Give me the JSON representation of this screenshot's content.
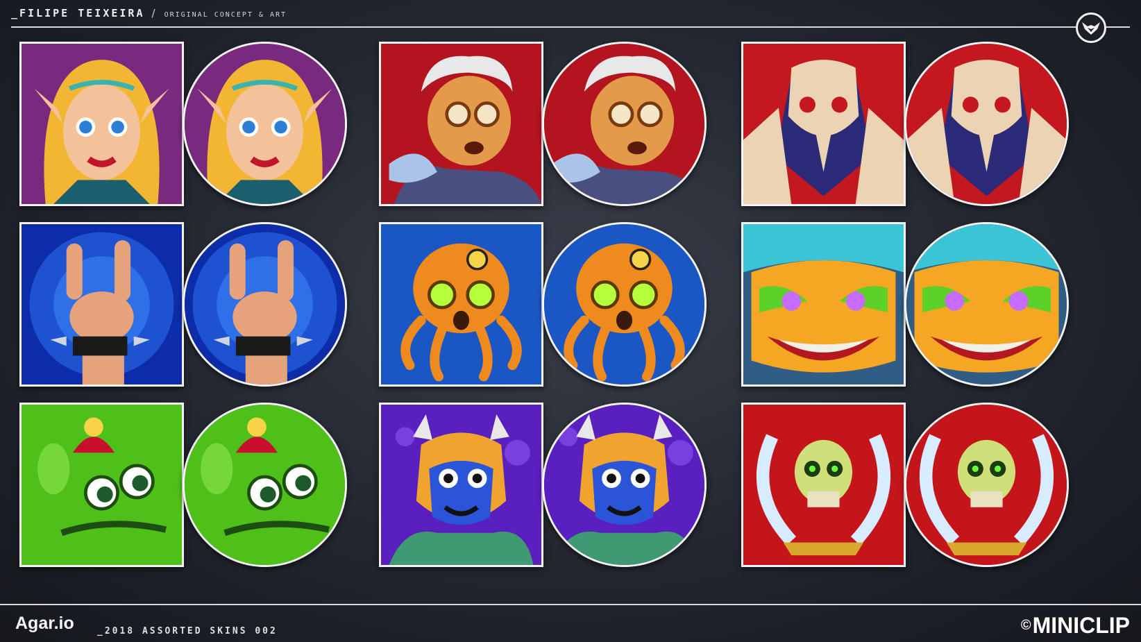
{
  "header": {
    "author": "_FILIPE TEIXEIRA",
    "separator": "/",
    "subtitle": "ORIGINAL CONCEPT & ART"
  },
  "footer": {
    "game_title": "Agar.io",
    "collection": "_2018 ASSORTED SKINS 002",
    "copyright_symbol": "©",
    "brand": "MINICLIP"
  },
  "badge": {
    "icon": "badger-logo-icon"
  },
  "skins": [
    {
      "id": "elf-princess",
      "icon": "elf-princess-icon",
      "bg": "#7a2a7e",
      "accent": "#f2b632"
    },
    {
      "id": "old-scientist",
      "icon": "old-scientist-icon",
      "bg": "#b3141f",
      "accent": "#e39a4b"
    },
    {
      "id": "bone-skull-demon",
      "icon": "bone-skull-demon-icon",
      "bg": "#c31820",
      "accent": "#ecd3b4"
    },
    {
      "id": "rock-hand",
      "icon": "rock-hand-icon",
      "bg": "#0d2ca8",
      "accent": "#e6a27a"
    },
    {
      "id": "robot-octopus",
      "icon": "robot-octopus-icon",
      "bg": "#1a57c4",
      "accent": "#ee8a1e"
    },
    {
      "id": "tiki-monster",
      "icon": "tiki-monster-icon",
      "bg": "#2f5d86",
      "accent": "#f5a623"
    },
    {
      "id": "green-blob",
      "icon": "green-blob-icon",
      "bg": "#4fbf19",
      "accent": "#c8102e"
    },
    {
      "id": "blue-lizard",
      "icon": "blue-lizard-icon",
      "bg": "#5a1fbf",
      "accent": "#f0a32e"
    },
    {
      "id": "skull-swords",
      "icon": "skull-swords-icon",
      "bg": "#c4151b",
      "accent": "#cfe07a"
    }
  ]
}
